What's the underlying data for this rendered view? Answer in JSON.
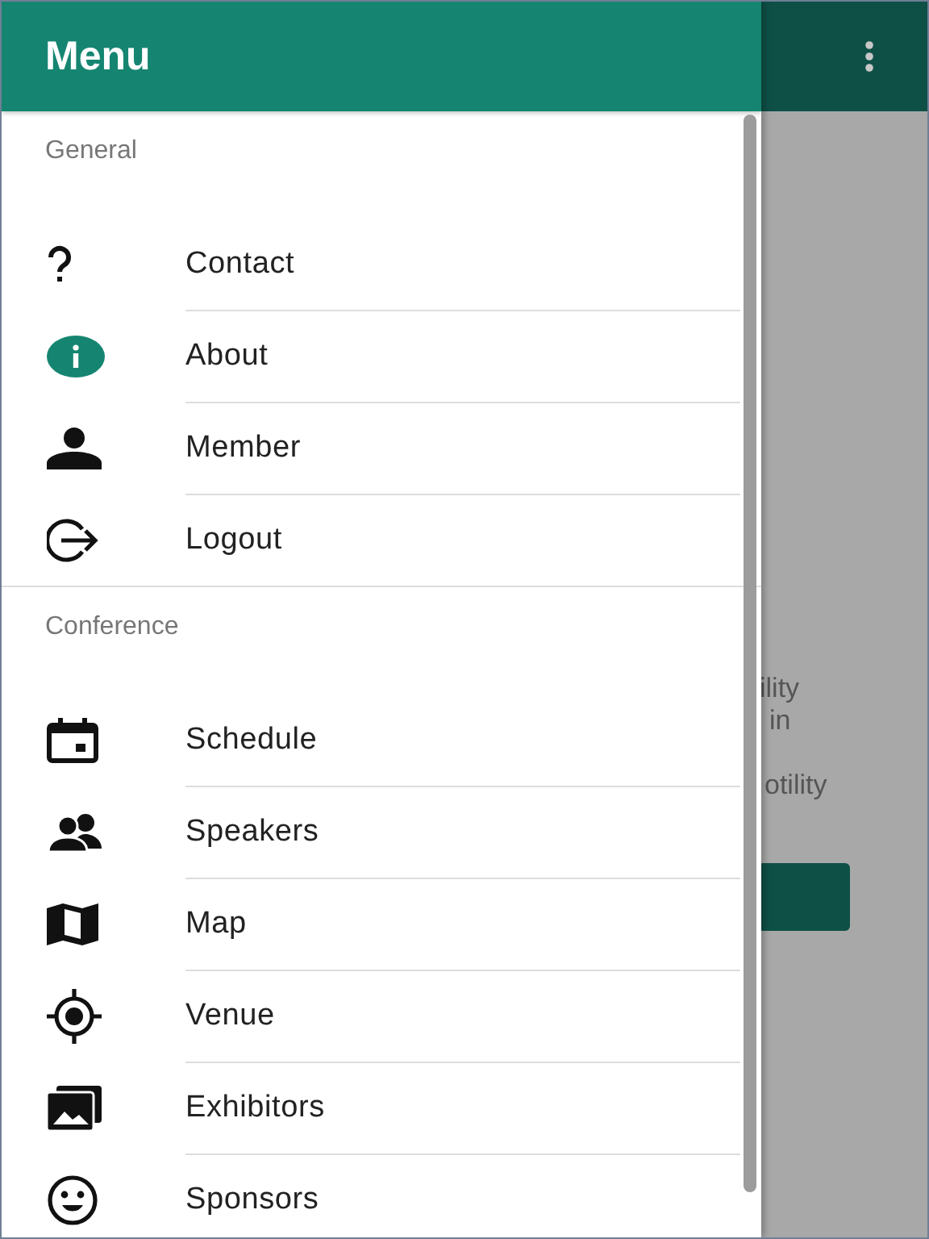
{
  "drawer": {
    "title": "Menu",
    "sections": [
      {
        "title": "General",
        "items": [
          {
            "label": "Contact"
          },
          {
            "label": "About"
          },
          {
            "label": "Member"
          },
          {
            "label": "Logout"
          }
        ]
      },
      {
        "title": "Conference",
        "items": [
          {
            "label": "Schedule"
          },
          {
            "label": "Speakers"
          },
          {
            "label": "Map"
          },
          {
            "label": "Venue"
          },
          {
            "label": "Exhibitors"
          },
          {
            "label": "Sponsors"
          }
        ]
      }
    ]
  },
  "background_page": {
    "text_lines": [
      "ility",
      "in",
      "otility"
    ]
  }
}
